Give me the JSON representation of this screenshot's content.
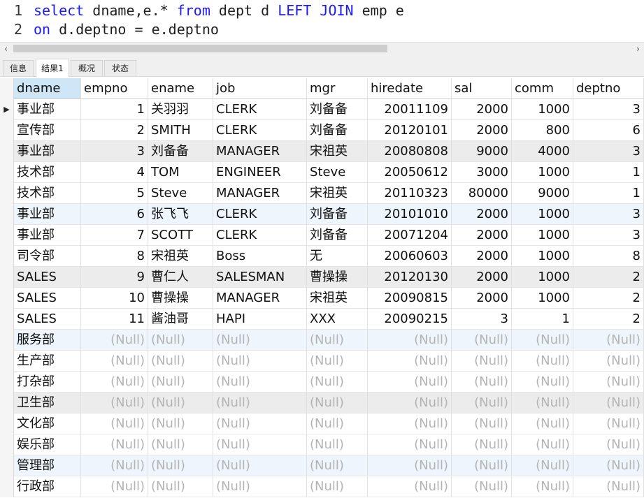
{
  "editor": {
    "lines": [
      {
        "num": "1",
        "tokens": [
          {
            "t": "select",
            "kw": true
          },
          {
            "t": " dname,e.* ",
            "kw": false
          },
          {
            "t": "from",
            "kw": true
          },
          {
            "t": " dept d ",
            "kw": false
          },
          {
            "t": "LEFT",
            "kw": true
          },
          {
            "t": " ",
            "kw": false
          },
          {
            "t": "JOIN",
            "kw": true
          },
          {
            "t": " emp e",
            "kw": false
          }
        ]
      },
      {
        "num": "2",
        "tokens": [
          {
            "t": "on",
            "kw": true
          },
          {
            "t": " d.deptno = e.deptno",
            "kw": false
          }
        ]
      }
    ],
    "keyword_color": "#1a1aff"
  },
  "scrollbar": {
    "left_arrow": "‹",
    "right_arrow": "›"
  },
  "tabs": [
    {
      "label": "信息",
      "active": false
    },
    {
      "label": "结果1",
      "active": true
    },
    {
      "label": "概况",
      "active": false
    },
    {
      "label": "状态",
      "active": false
    }
  ],
  "grid": {
    "columns": [
      {
        "label": "dname",
        "align": "left"
      },
      {
        "label": "empno",
        "align": "right"
      },
      {
        "label": "ename",
        "align": "left"
      },
      {
        "label": "job",
        "align": "left"
      },
      {
        "label": "mgr",
        "align": "left"
      },
      {
        "label": "hiredate",
        "align": "right"
      },
      {
        "label": "sal",
        "align": "right"
      },
      {
        "label": "comm",
        "align": "right"
      },
      {
        "label": "deptno",
        "align": "right"
      }
    ],
    "current_row_marker": "▶",
    "null_text": "(Null)",
    "rows": [
      {
        "style": "sel",
        "cells": [
          "事业部",
          "1",
          "关羽羽",
          "CLERK",
          "刘备备",
          "20011109",
          "2000",
          "1000",
          "3"
        ]
      },
      {
        "style": "",
        "cells": [
          "宣传部",
          "2",
          "SMITH",
          "CLERK",
          "刘备备",
          "20120101",
          "2000",
          "800",
          "6"
        ]
      },
      {
        "style": "gray",
        "cells": [
          "事业部",
          "3",
          "刘备备",
          "MANAGER",
          "宋祖英",
          "20080808",
          "9000",
          "4000",
          "3"
        ]
      },
      {
        "style": "",
        "cells": [
          "技术部",
          "4",
          "TOM",
          "ENGINEER",
          "Steve",
          "20050612",
          "3000",
          "1000",
          "1"
        ]
      },
      {
        "style": "",
        "cells": [
          "技术部",
          "5",
          "Steve",
          "MANAGER",
          "宋祖英",
          "20110323",
          "80000",
          "9000",
          "1"
        ]
      },
      {
        "style": "blue",
        "cells": [
          "事业部",
          "6",
          "张飞飞",
          "CLERK",
          "刘备备",
          "20101010",
          "2000",
          "1000",
          "3"
        ]
      },
      {
        "style": "",
        "cells": [
          "事业部",
          "7",
          "SCOTT",
          "CLERK",
          "刘备备",
          "20071204",
          "2000",
          "1000",
          "3"
        ]
      },
      {
        "style": "",
        "cells": [
          "司令部",
          "8",
          "宋祖英",
          "Boss",
          "无",
          "20060603",
          "2000",
          "1000",
          "8"
        ]
      },
      {
        "style": "gray",
        "cells": [
          "SALES",
          "9",
          "曹仁人",
          "SALESMAN",
          "曹操操",
          "20120130",
          "2000",
          "1000",
          "2"
        ]
      },
      {
        "style": "",
        "cells": [
          "SALES",
          "10",
          "曹操操",
          "MANAGER",
          "宋祖英",
          "20090815",
          "2000",
          "1000",
          "2"
        ]
      },
      {
        "style": "",
        "cells": [
          "SALES",
          "11",
          "酱油哥",
          "HAPI",
          "XXX",
          "20090215",
          "3",
          "1",
          "2"
        ]
      },
      {
        "style": "blue",
        "cells": [
          "服务部",
          null,
          null,
          null,
          null,
          null,
          null,
          null,
          null
        ]
      },
      {
        "style": "",
        "cells": [
          "生产部",
          null,
          null,
          null,
          null,
          null,
          null,
          null,
          null
        ]
      },
      {
        "style": "",
        "cells": [
          "打杂部",
          null,
          null,
          null,
          null,
          null,
          null,
          null,
          null
        ]
      },
      {
        "style": "gray",
        "cells": [
          "卫生部",
          null,
          null,
          null,
          null,
          null,
          null,
          null,
          null
        ]
      },
      {
        "style": "",
        "cells": [
          "文化部",
          null,
          null,
          null,
          null,
          null,
          null,
          null,
          null
        ]
      },
      {
        "style": "",
        "cells": [
          "娱乐部",
          null,
          null,
          null,
          null,
          null,
          null,
          null,
          null
        ]
      },
      {
        "style": "blue",
        "cells": [
          "管理部",
          null,
          null,
          null,
          null,
          null,
          null,
          null,
          null
        ]
      },
      {
        "style": "",
        "cells": [
          "行政部",
          null,
          null,
          null,
          null,
          null,
          null,
          null,
          null
        ]
      }
    ]
  }
}
